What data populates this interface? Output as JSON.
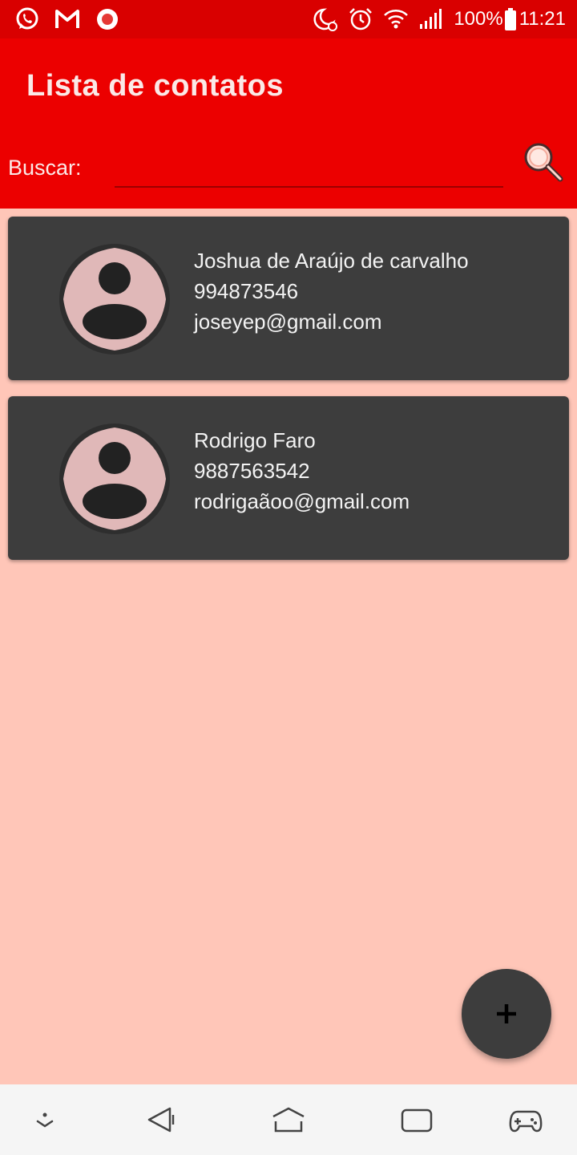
{
  "status_bar": {
    "battery": "100%",
    "time": "11:21",
    "left_icons": [
      "whatsapp-icon",
      "gmail-icon",
      "recording-icon"
    ],
    "right_icons": [
      "do-not-disturb-icon",
      "alarm-icon",
      "wifi-icon",
      "signal-icon",
      "battery-icon"
    ]
  },
  "app_bar": {
    "title": "Lista de contatos",
    "search_label": "Buscar:",
    "search_value": ""
  },
  "contacts": [
    {
      "name": "Joshua de Araújo de carvalho",
      "phone": "994873546",
      "email": "joseyep@gmail.com"
    },
    {
      "name": "Rodrigo Faro",
      "phone": "9887563542",
      "email": "rodrigaãoo@gmail.com"
    }
  ],
  "fab": {
    "icon": "plus-icon"
  },
  "nav_bar": {
    "icons": [
      "hide-nav-icon",
      "back-icon",
      "home-icon",
      "recents-icon",
      "game-launcher-icon"
    ]
  },
  "colors": {
    "status_bar": "#d90000",
    "app_bar": "#ec0000",
    "background": "#ffc6b8",
    "card": "#3d3d3d",
    "avatar_bg": "#e0b8b8"
  }
}
